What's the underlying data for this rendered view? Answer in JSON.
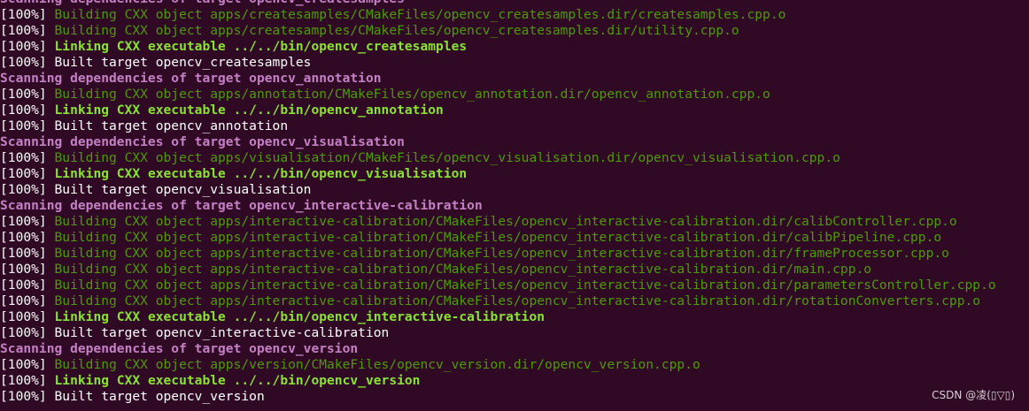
{
  "terminal": {
    "lines": [
      {
        "prefix": "",
        "text": "Scanning dependencies of target opencv_createsamples",
        "kind": "scan"
      },
      {
        "prefix": "[100%] ",
        "text": "Building CXX object apps/createsamples/CMakeFiles/opencv_createsamples.dir/createsamples.cpp.o",
        "kind": "build"
      },
      {
        "prefix": "[100%] ",
        "text": "Building CXX object apps/createsamples/CMakeFiles/opencv_createsamples.dir/utility.cpp.o",
        "kind": "build"
      },
      {
        "prefix": "[100%] ",
        "text": "Linking CXX executable ../../bin/opencv_createsamples",
        "kind": "link"
      },
      {
        "prefix": "[100%] ",
        "text": "Built target opencv_createsamples",
        "kind": "built"
      },
      {
        "prefix": "",
        "text": "Scanning dependencies of target opencv_annotation",
        "kind": "scan"
      },
      {
        "prefix": "[100%] ",
        "text": "Building CXX object apps/annotation/CMakeFiles/opencv_annotation.dir/opencv_annotation.cpp.o",
        "kind": "build"
      },
      {
        "prefix": "[100%] ",
        "text": "Linking CXX executable ../../bin/opencv_annotation",
        "kind": "link"
      },
      {
        "prefix": "[100%] ",
        "text": "Built target opencv_annotation",
        "kind": "built"
      },
      {
        "prefix": "",
        "text": "Scanning dependencies of target opencv_visualisation",
        "kind": "scan"
      },
      {
        "prefix": "[100%] ",
        "text": "Building CXX object apps/visualisation/CMakeFiles/opencv_visualisation.dir/opencv_visualisation.cpp.o",
        "kind": "build"
      },
      {
        "prefix": "[100%] ",
        "text": "Linking CXX executable ../../bin/opencv_visualisation",
        "kind": "link"
      },
      {
        "prefix": "[100%] ",
        "text": "Built target opencv_visualisation",
        "kind": "built"
      },
      {
        "prefix": "",
        "text": "Scanning dependencies of target opencv_interactive-calibration",
        "kind": "scan"
      },
      {
        "prefix": "[100%] ",
        "text": "Building CXX object apps/interactive-calibration/CMakeFiles/opencv_interactive-calibration.dir/calibController.cpp.o",
        "kind": "build"
      },
      {
        "prefix": "[100%] ",
        "text": "Building CXX object apps/interactive-calibration/CMakeFiles/opencv_interactive-calibration.dir/calibPipeline.cpp.o",
        "kind": "build"
      },
      {
        "prefix": "[100%] ",
        "text": "Building CXX object apps/interactive-calibration/CMakeFiles/opencv_interactive-calibration.dir/frameProcessor.cpp.o",
        "kind": "build"
      },
      {
        "prefix": "[100%] ",
        "text": "Building CXX object apps/interactive-calibration/CMakeFiles/opencv_interactive-calibration.dir/main.cpp.o",
        "kind": "build"
      },
      {
        "prefix": "[100%] ",
        "text": "Building CXX object apps/interactive-calibration/CMakeFiles/opencv_interactive-calibration.dir/parametersController.cpp.o",
        "kind": "build"
      },
      {
        "prefix": "[100%] ",
        "text": "Building CXX object apps/interactive-calibration/CMakeFiles/opencv_interactive-calibration.dir/rotationConverters.cpp.o",
        "kind": "build"
      },
      {
        "prefix": "[100%] ",
        "text": "Linking CXX executable ../../bin/opencv_interactive-calibration",
        "kind": "link"
      },
      {
        "prefix": "[100%] ",
        "text": "Built target opencv_interactive-calibration",
        "kind": "built"
      },
      {
        "prefix": "",
        "text": "Scanning dependencies of target opencv_version",
        "kind": "scan"
      },
      {
        "prefix": "[100%] ",
        "text": "Building CXX object apps/version/CMakeFiles/opencv_version.dir/opencv_version.cpp.o",
        "kind": "build"
      },
      {
        "prefix": "[100%] ",
        "text": "Linking CXX executable ../../bin/opencv_version",
        "kind": "link"
      },
      {
        "prefix": "[100%] ",
        "text": "Built target opencv_version",
        "kind": "built"
      }
    ]
  },
  "watermark": {
    "text": "CSDN @凌(▯▽▯)"
  },
  "colors": {
    "background": "#300a24",
    "scan": "#c480c4",
    "build": "#4e9a06",
    "link": "#8ae234",
    "plain": "#ffffff"
  }
}
